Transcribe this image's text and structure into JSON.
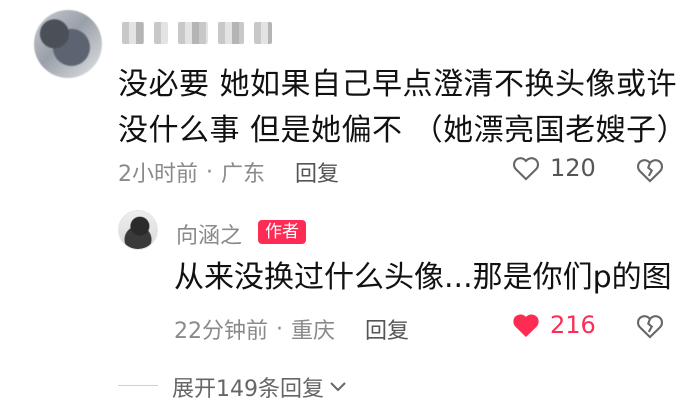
{
  "comment": {
    "username_obscured": "",
    "text": "没必要 她如果自己早点澄清不换头像或许没什么事 但是她偏不 （她漂亮国老嫂子）",
    "time": "2小时前",
    "location": "广东",
    "reply_label": "回复",
    "like_count": "120",
    "icons": {
      "like": "heart-outline-icon",
      "dislike": "broken-heart-icon"
    }
  },
  "reply": {
    "username": "向涵之",
    "badge": "作者",
    "text": "从来没换过什么头像...那是你们p的图",
    "time": "22分钟前",
    "location": "重庆",
    "reply_label": "回复",
    "like_count": "216",
    "liked": true,
    "colors": {
      "badge": "#fe2c55",
      "liked_heart": "#fe2c55"
    }
  },
  "expand_label": "展开149条回复"
}
